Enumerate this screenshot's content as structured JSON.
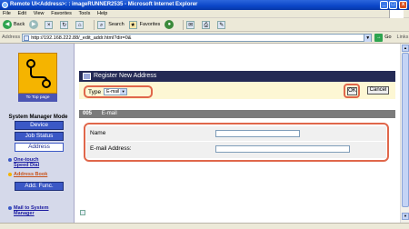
{
  "window": {
    "title": "Remote UI<Address>: : imageRUNNER2535 - Microsoft Internet Explorer",
    "minimize": "_",
    "maximize": "□",
    "close": "x"
  },
  "menubar": {
    "items": [
      "File",
      "Edit",
      "View",
      "Favorites",
      "Tools",
      "Help"
    ]
  },
  "toolbar": {
    "back_label": "Back",
    "forward_label": "",
    "search_label": "Search",
    "favorites_label": "Favorites"
  },
  "addressbar": {
    "label": "Address",
    "url": "http://192.168.222.88/_edit_addr.html?dir=0&",
    "go_label": "Go",
    "links_label": "Links"
  },
  "sidebar": {
    "top_page_label": "To Top page",
    "mode_title": "System Manager Mode",
    "buttons": [
      {
        "label": "Device"
      },
      {
        "label": "Job Status"
      },
      {
        "label": "Address"
      }
    ],
    "links": [
      {
        "label_1": "One-touch",
        "label_2": "Speed Dial"
      },
      {
        "label_1": "Address Book",
        "label_2": ""
      }
    ],
    "add_func_label": "Add. Func.",
    "mail_link_1": "Mail to System",
    "mail_link_2": "Manager"
  },
  "main": {
    "header_title": "Register New Address",
    "type_label": "Type",
    "type_value": "E-mail",
    "ok_label": "OK",
    "cancel_label": "Cancel",
    "section_number": "005",
    "section_title": "E-mail",
    "fields": [
      {
        "label": "Name",
        "value": ""
      },
      {
        "label": "E-mail Address:",
        "value": ""
      }
    ]
  }
}
